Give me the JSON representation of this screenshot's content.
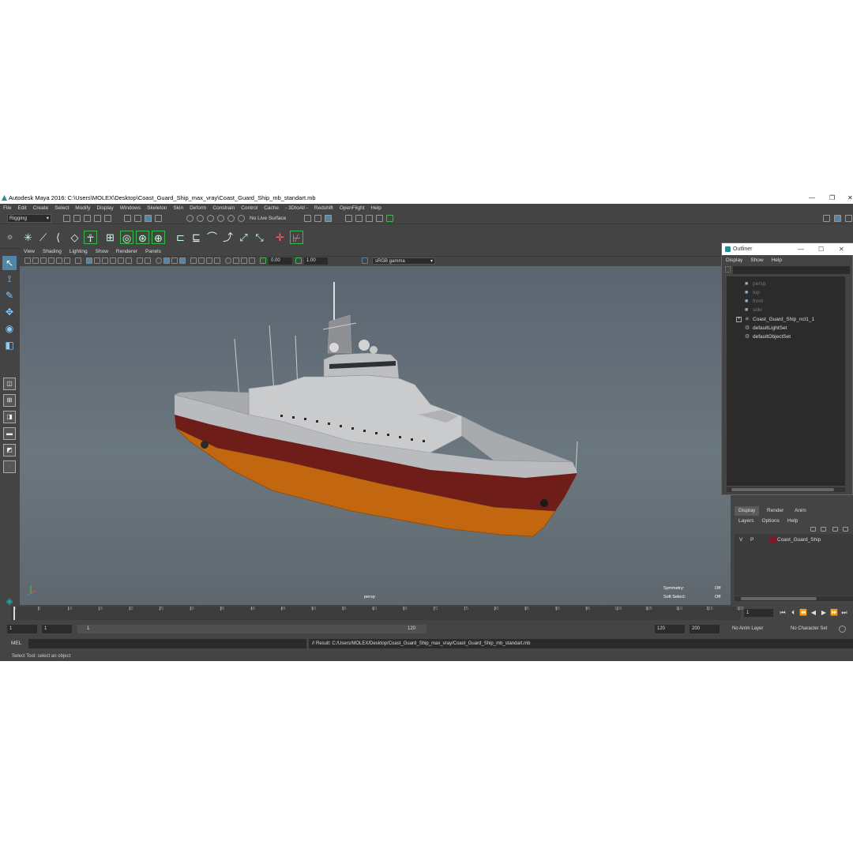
{
  "window": {
    "title": "Autodesk Maya 2016: C:\\Users\\MOLEX\\Desktop\\Coast_Guard_Ship_max_vray\\Coast_Guard_Ship_mb_standart.mb",
    "minimize": "—",
    "maximize": "❐",
    "close": "✕"
  },
  "menubar": [
    "File",
    "Edit",
    "Create",
    "Select",
    "Modify",
    "Display",
    "Windows",
    "Skeleton",
    "Skin",
    "Deform",
    "Constrain",
    "Control",
    "Cache",
    "- 3DtoAll -",
    "Redshift",
    "OpenFlight",
    "Help"
  ],
  "statusline": {
    "mode": "Rigging",
    "live_surface": "No Live Surface"
  },
  "viewport": {
    "menu": [
      "View",
      "Shading",
      "Lighting",
      "Show",
      "Renderer",
      "Panels"
    ],
    "exposure": "0.00",
    "gamma": "1.00",
    "color_space": "sRGB gamma",
    "camera_label": "persp",
    "hud": {
      "symmetry_label": "Symmetry:",
      "symmetry_value": "Off",
      "soft_select_label": "Soft Select:",
      "soft_select_value": "Off"
    }
  },
  "outliner": {
    "title": "Outliner",
    "menu": [
      "Display",
      "Show",
      "Help"
    ],
    "items": [
      {
        "label": "persp",
        "icon": "camera-icon",
        "kind": "cam"
      },
      {
        "label": "top",
        "icon": "camera-icon",
        "kind": "cam"
      },
      {
        "label": "front",
        "icon": "camera-icon",
        "kind": "cam"
      },
      {
        "label": "side",
        "icon": "camera-icon",
        "kind": "cam"
      },
      {
        "label": "Coast_Guard_Ship_ncl1_1",
        "icon": "mesh-group-icon",
        "kind": "node",
        "expandable": true
      },
      {
        "label": "defaultLightSet",
        "icon": "set-icon",
        "kind": "node"
      },
      {
        "label": "defaultObjectSet",
        "icon": "set-icon",
        "kind": "node"
      }
    ]
  },
  "layer_editor": {
    "tabs": [
      "Display",
      "Render",
      "Anim"
    ],
    "active_tab": "Display",
    "menu": [
      "Layers",
      "Options",
      "Help"
    ],
    "layers": [
      {
        "v": "V",
        "p": "P",
        "name": "Coast_Guard_Ship",
        "color": "#7a1a2a"
      }
    ]
  },
  "timeline": {
    "ticks": [
      1,
      5,
      10,
      15,
      20,
      25,
      30,
      35,
      40,
      45,
      50,
      55,
      60,
      65,
      70,
      75,
      80,
      85,
      90,
      95,
      100,
      105,
      110,
      115,
      120
    ],
    "labels": [
      "1",
      "5",
      "10",
      "15",
      "20",
      "25",
      "30",
      "35",
      "40",
      "45",
      "50",
      "55",
      "60",
      "65",
      "70",
      "75",
      "80",
      "85",
      "90",
      "95",
      "100",
      "105",
      "110",
      "115",
      "120"
    ],
    "current_frame": "1"
  },
  "range": {
    "start": "1",
    "playback_start": "1",
    "range_start_label": "1",
    "range_end_label": "120",
    "playback_end": "120",
    "end": "200",
    "anim_layer": "No Anim Layer",
    "character_set": "No Character Set"
  },
  "command": {
    "label": "MEL",
    "result": "// Result: C:/Users/MOLEX/Desktop/Coast_Guard_Ship_max_vray/Coast_Guard_Ship_mb_standart.mb"
  },
  "help_line": "Select Tool: select an object",
  "colors": {
    "accent": "#5285a6",
    "ship_hull_red": "#7a1f1a",
    "ship_hull_orange": "#c86a12",
    "ship_superstructure": "#c9cacc"
  }
}
